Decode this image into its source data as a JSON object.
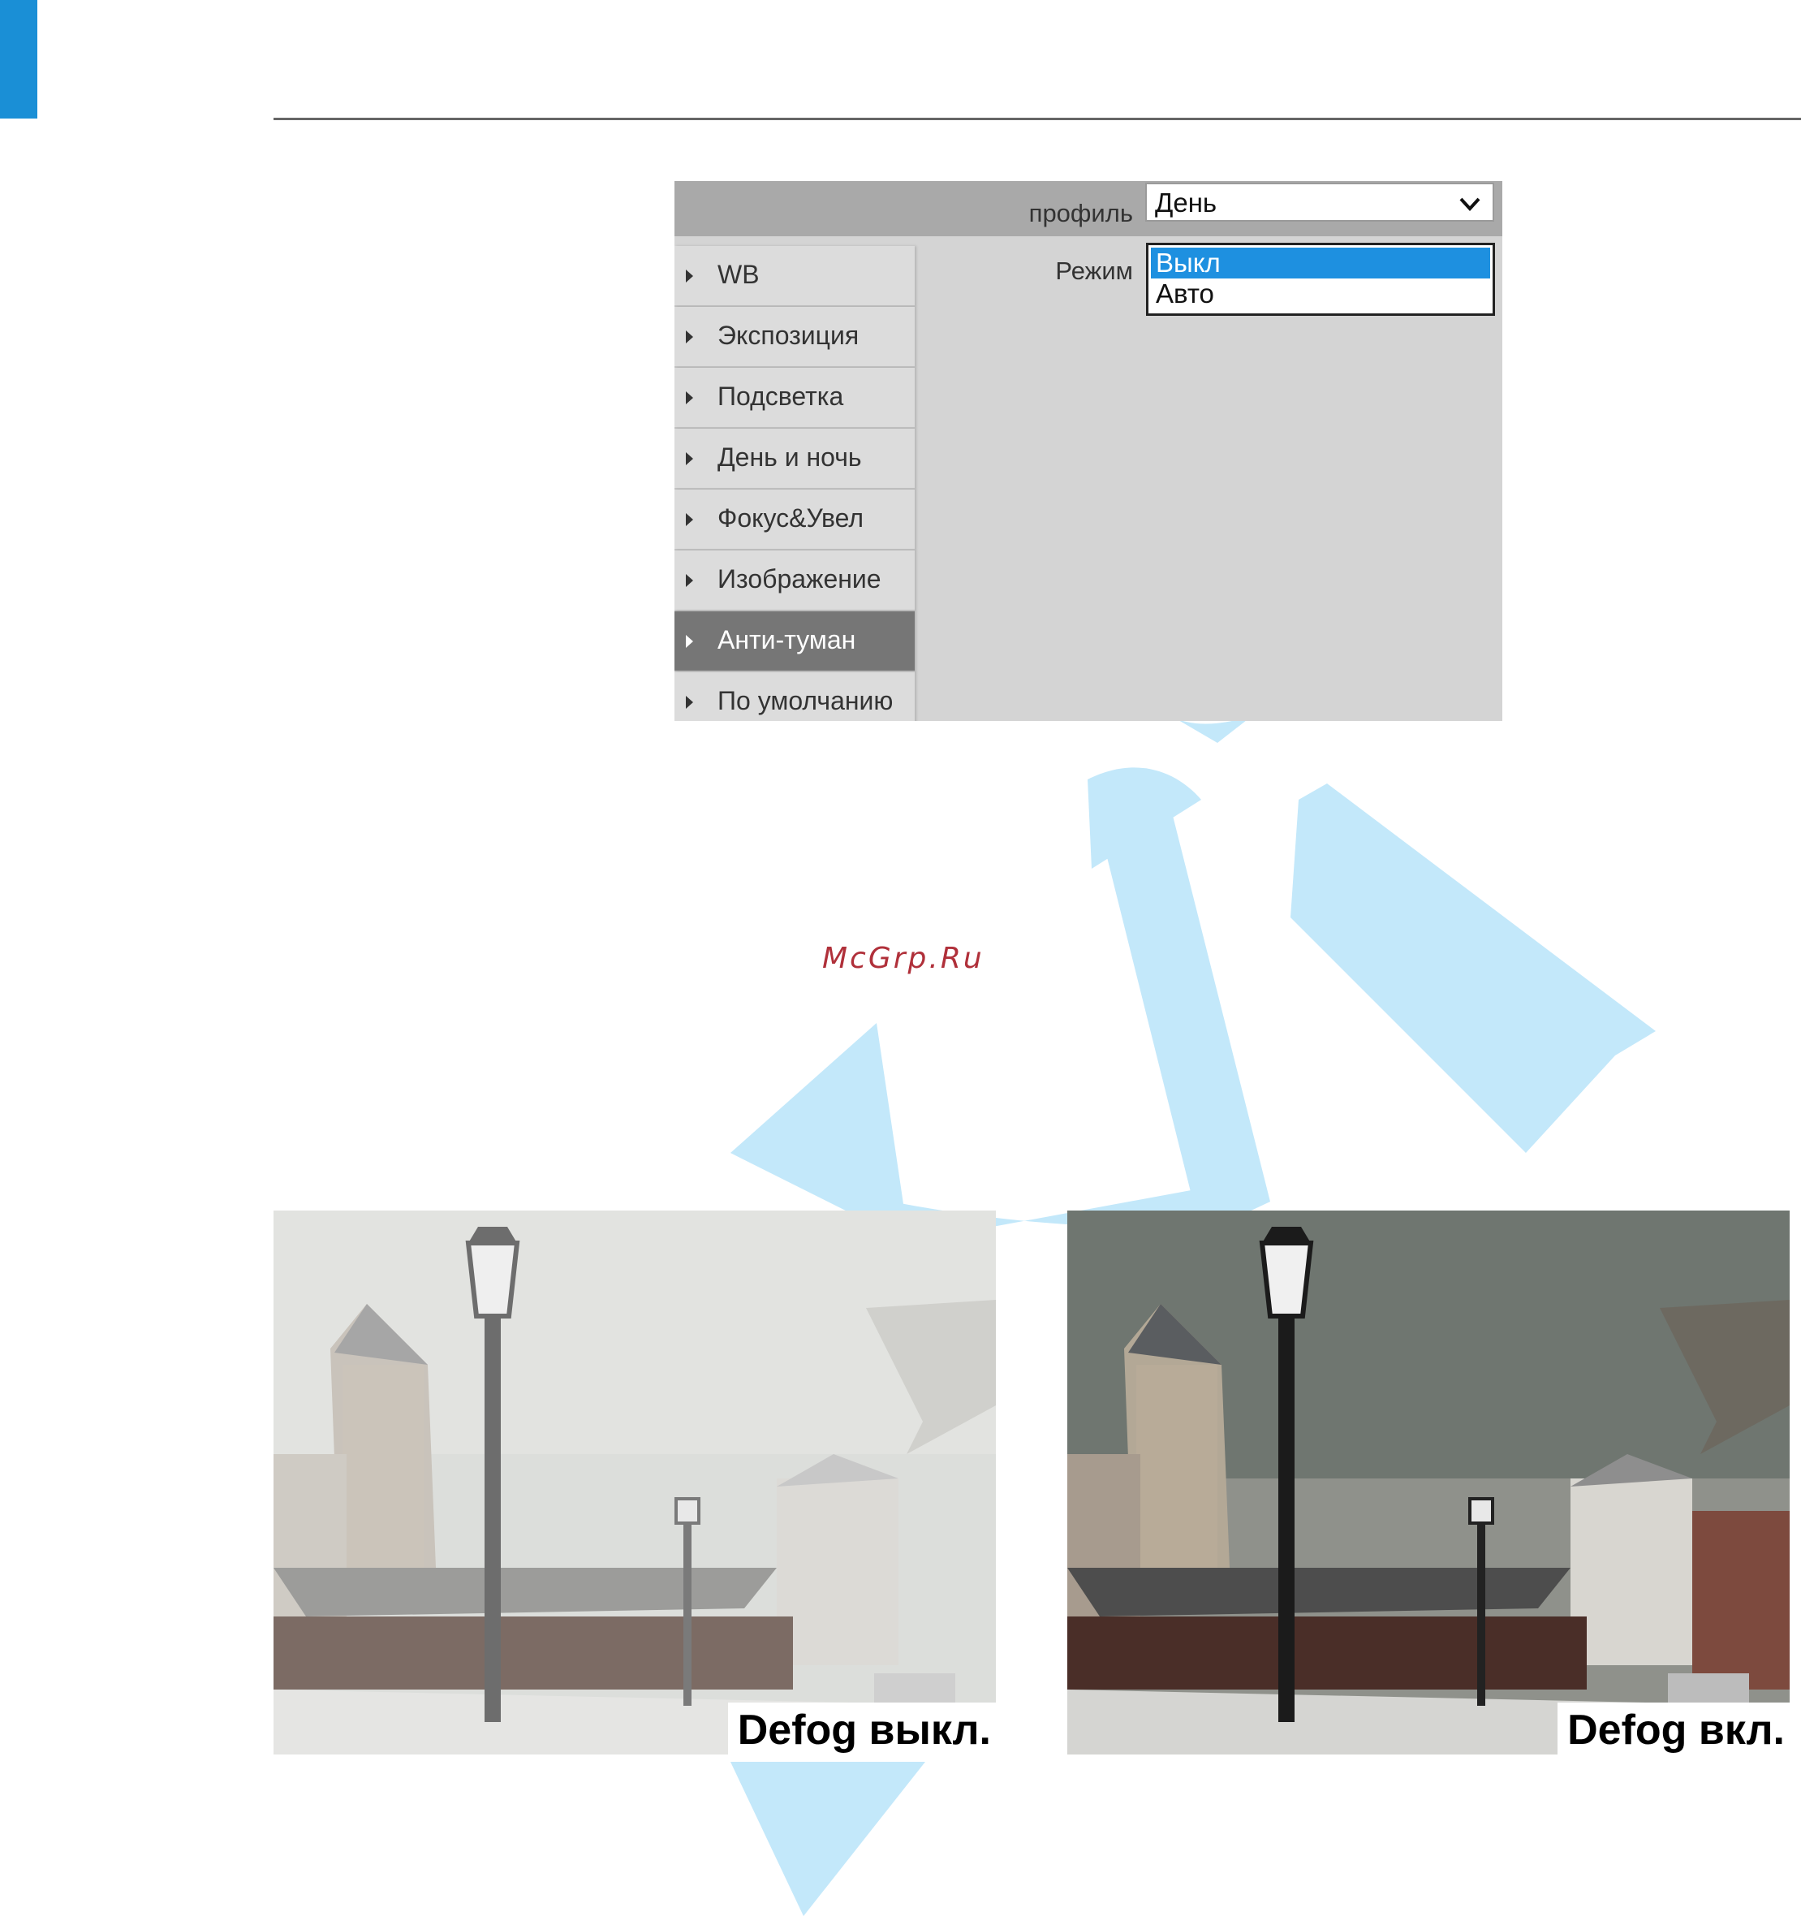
{
  "panel": {
    "profile_label": "профиль",
    "profile_value": "День",
    "mode_label": "Режим",
    "mode_options": [
      "Выкл",
      "Авто"
    ],
    "mode_selected": "Выкл",
    "menu": [
      {
        "label": "WB",
        "active": false
      },
      {
        "label": "Экспозиция",
        "active": false
      },
      {
        "label": "Подсветка",
        "active": false
      },
      {
        "label": "День и ночь",
        "active": false
      },
      {
        "label": "Фокус&Увел",
        "active": false
      },
      {
        "label": "Изображение",
        "active": false
      },
      {
        "label": "Анти-туман",
        "active": true
      },
      {
        "label": "По умолчанию",
        "active": false
      }
    ]
  },
  "watermark": "McGrp.Ru",
  "photos": [
    {
      "caption": "Defog выкл."
    },
    {
      "caption": "Defog вкл."
    }
  ],
  "colors": {
    "accent": "#1a8fd6",
    "selection": "#1e90e0",
    "logo_watermark": "#c3e8fa"
  }
}
